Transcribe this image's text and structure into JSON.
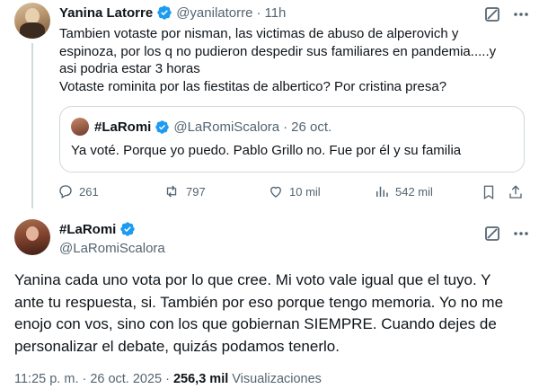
{
  "first_tweet": {
    "display_name": "Yanina Latorre",
    "handle": "@yanilatorre",
    "separator": "·",
    "time": "11h",
    "text_lines": [
      "Tambien votaste por nisman, las victimas de  abuso de alperovich y",
      "espinoza, por los q no pudieron despedir sus familiares en pandemia.....y",
      "asi podria estar 3 horas",
      "Votaste rominita por las fiestitas de albertico? Por cristina presa?"
    ],
    "quote": {
      "display_name": "#LaRomi",
      "handle": "@LaRomiScalora",
      "separator": "·",
      "date": "26 oct.",
      "text": "Ya voté. Porque yo puedo. Pablo Grillo no. Fue por él y su familia"
    },
    "actions": {
      "replies": "261",
      "retweets": "797",
      "likes": "10 mil",
      "views": "542 mil"
    }
  },
  "reply_tweet": {
    "display_name": "#LaRomi",
    "handle": "@LaRomiScalora",
    "text_lines": [
      "Yanina cada uno vota por lo que cree. Mi voto vale igual que el tuyo. Y",
      "ante tu respuesta, si. También por eso porque tengo memoria. Yo no me",
      "enojo con vos, sino con los que gobiernan SIEMPRE. Cuando dejes de",
      "personalizar el debate, quizás podamos tenerlo."
    ],
    "time": "11:25 p. m.",
    "separator": "·",
    "date": "26 oct. 2025",
    "separator2": "·",
    "views_count": "256,3 mil",
    "views_label": "Visualizaciones"
  },
  "colors": {
    "verified": "#1d9bf0",
    "secondary_text": "#536471",
    "border": "#cfd9de"
  }
}
